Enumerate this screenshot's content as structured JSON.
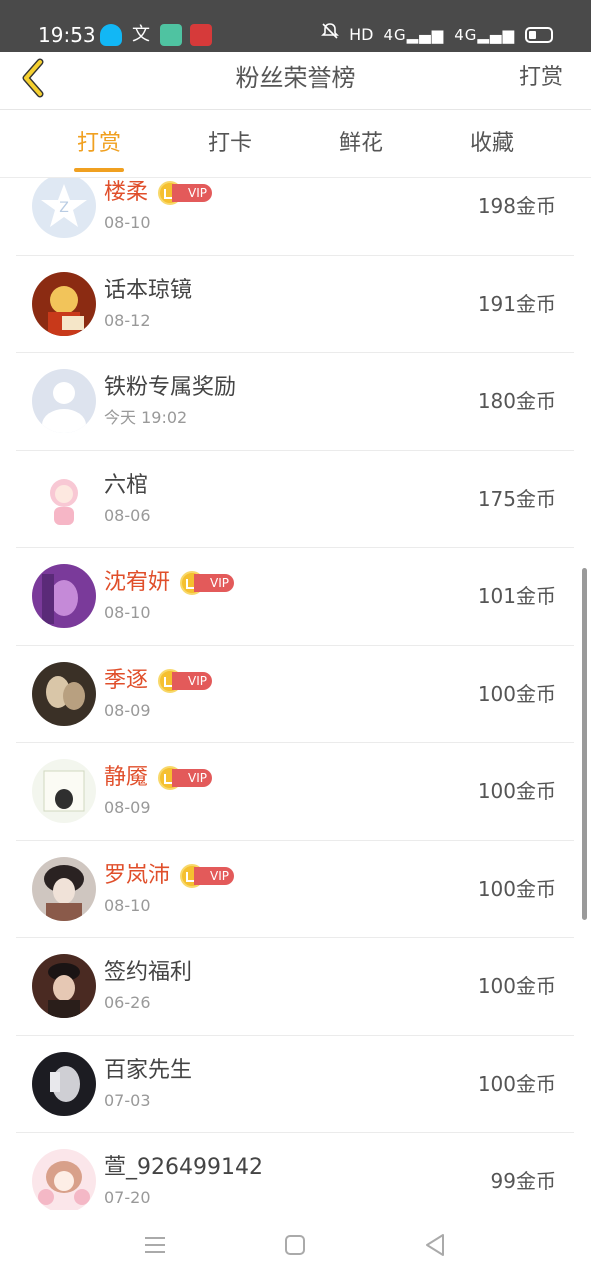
{
  "status_bar": {
    "time": "19:53",
    "notification_icons": [
      "qq-icon",
      "translate-icon",
      "app-icon",
      "heart-app-icon"
    ],
    "right_text": "HD",
    "network1": "4G",
    "network2": "4G"
  },
  "header": {
    "title": "粉丝荣誉榜",
    "action_label": "打赏",
    "accent_color": "#f0a020"
  },
  "tabs": [
    {
      "label": "打赏",
      "active": true
    },
    {
      "label": "打卡",
      "active": false
    },
    {
      "label": "鲜花",
      "active": false
    },
    {
      "label": "收藏",
      "active": false
    }
  ],
  "vip_label": "VIP",
  "fans": [
    {
      "name": "楼柔",
      "date": "08-10",
      "amount": "198金币",
      "vip": true
    },
    {
      "name": "话本琼镜",
      "date": "08-12",
      "amount": "191金币",
      "vip": false
    },
    {
      "name": "铁粉专属奖励",
      "date": "今天 19:02",
      "amount": "180金币",
      "vip": false
    },
    {
      "name": "六棺",
      "date": "08-06",
      "amount": "175金币",
      "vip": false
    },
    {
      "name": "沈宥妍",
      "date": "08-10",
      "amount": "101金币",
      "vip": true
    },
    {
      "name": "季逐",
      "date": "08-09",
      "amount": "100金币",
      "vip": true
    },
    {
      "name": "静魇",
      "date": "08-09",
      "amount": "100金币",
      "vip": true
    },
    {
      "name": "罗岚沛",
      "date": "08-10",
      "amount": "100金币",
      "vip": true
    },
    {
      "name": "签约福利",
      "date": "06-26",
      "amount": "100金币",
      "vip": false
    },
    {
      "name": "百家先生",
      "date": "07-03",
      "amount": "100金币",
      "vip": false
    },
    {
      "name": "萱_926499142",
      "date": "07-20",
      "amount": "99金币",
      "vip": false
    }
  ]
}
